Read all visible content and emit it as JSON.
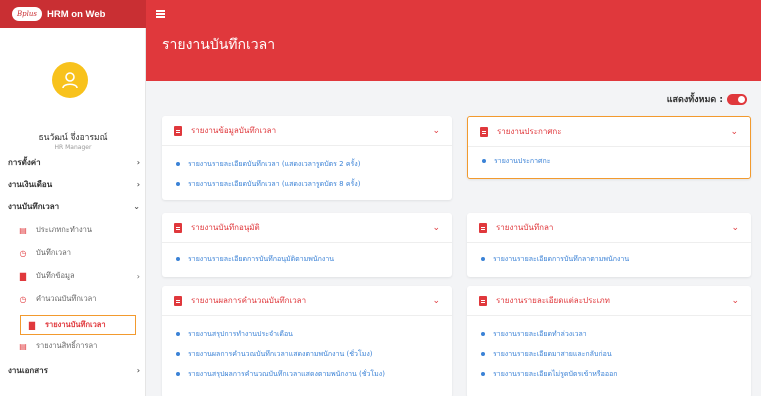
{
  "app": {
    "title": "HRM on Web",
    "logo_text": "Bplus"
  },
  "page": {
    "title": "รายงานบันทึกเวลา"
  },
  "user": {
    "name": "ธนวัฒน์ จึ่งอารมณ์",
    "role": "HR Manager"
  },
  "show_all": {
    "label": "แสดงทั้งหมด :"
  },
  "sidebar": {
    "items": [
      {
        "label": "การตั้งค่า",
        "chevron": "›"
      },
      {
        "label": "งานเงินเดือน",
        "chevron": "›"
      },
      {
        "label": "งานบันทึกเวลา",
        "chevron": "⌄"
      }
    ],
    "sub_items": [
      {
        "label": "ประเภทกะทำงาน",
        "icon": "calendar-icon"
      },
      {
        "label": "บันทึกเวลา",
        "icon": "clock-icon"
      },
      {
        "label": "บันทึกข้อมูล",
        "icon": "document-icon",
        "arrow": "›"
      },
      {
        "label": "คำนวณบันทึกเวลา",
        "icon": "clock-icon"
      },
      {
        "label": "รายงานบันทึกเวลา",
        "icon": "document-icon",
        "active": true
      },
      {
        "label": "รายงานสิทธิ์การลา",
        "icon": "calendar-icon"
      }
    ],
    "bottom_item": {
      "label": "งานเอกสาร",
      "chevron": "›"
    }
  },
  "cards": [
    {
      "title": "รายงานข้อมูลบันทึกเวลา",
      "links": [
        "รายงานรายละเอียดบันทึกเวลา (แสดงเวลารูดบัตร 2 ครั้ง)",
        "รายงานรายละเอียดบันทึกเวลา (แสดงเวลารูดบัตร 8 ครั้ง)"
      ]
    },
    {
      "title": "รายงานประกาศกะ",
      "links": [
        "รายงานประกาศกะ"
      ]
    },
    {
      "title": "รายงานบันทึกอนุมัติ",
      "links": [
        "รายงานรายละเอียดการบันทึกอนุมัติตามพนักงาน"
      ]
    },
    {
      "title": "รายงานบันทึกลา",
      "links": [
        "รายงานรายละเอียดการบันทึกลาตามพนักงาน"
      ]
    },
    {
      "title": "รายงานผลการคำนวณบันทึกเวลา",
      "links": [
        "รายงานสรุปการทำงานประจำเดือน",
        "รายงานผลการคำนวณบันทึกเวลาแสดงตามพนักงาน (ชั่วโมง)",
        "รายงานสรุปผลการคำนวณบันทึกเวลาแสดงตามพนักงาน (ชั่วโมง)"
      ]
    },
    {
      "title": "รายงานรายละเอียดแต่ละประเภท",
      "links": [
        "รายงานรายละเอียดทำล่วงเวลา",
        "รายงานรายละเอียดมาสายและกลับก่อน",
        "รายงานรายละเอียดไม่รูดบัตรเข้าหรือออก"
      ]
    }
  ],
  "colors": {
    "brand": "#e0383c",
    "link": "#3b82d6",
    "highlight": "#f29a2e",
    "avatar": "#f8c21c"
  }
}
